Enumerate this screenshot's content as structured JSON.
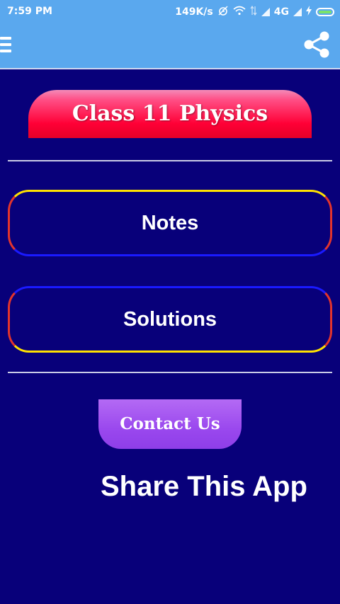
{
  "status_bar": {
    "time": "7:59 PM",
    "network_speed": "149K/s",
    "network_type": "4G",
    "icons": [
      "alarm-off-icon",
      "wifi-icon",
      "data-arrows-icon",
      "signal-icon",
      "signal-icon",
      "charging-icon",
      "battery-icon"
    ]
  },
  "toolbar": {
    "menu_icon": "hamburger-menu-icon",
    "share_icon": "share-icon"
  },
  "main": {
    "title_button": "Class 11 Physics",
    "notes_button": "Notes",
    "solutions_button": "Solutions",
    "contact_button": "Contact Us",
    "share_text": "Share This App"
  },
  "colors": {
    "background": "#08007a",
    "toolbar": "#5aa8ee",
    "title_button": "#ff0036",
    "contact_button": "#9a48ee",
    "outline_blue": "#1a1aff",
    "outline_yellow": "#ffe200",
    "outline_red": "#e3342c"
  }
}
